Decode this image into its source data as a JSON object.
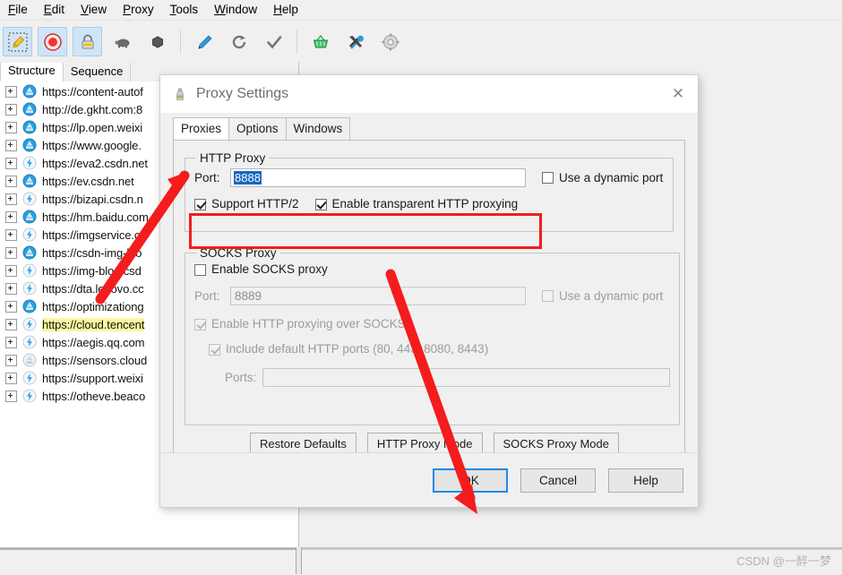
{
  "menubar": {
    "items": [
      {
        "label": "File",
        "accel": "F"
      },
      {
        "label": "Edit",
        "accel": "E"
      },
      {
        "label": "View",
        "accel": "V"
      },
      {
        "label": "Proxy",
        "accel": "P"
      },
      {
        "label": "Tools",
        "accel": "T"
      },
      {
        "label": "Window",
        "accel": "W"
      },
      {
        "label": "Help",
        "accel": "H"
      }
    ]
  },
  "toolbar": {
    "buttons": [
      {
        "name": "clear-session-icon",
        "selected": true
      },
      {
        "name": "record-icon",
        "selected": true
      },
      {
        "name": "ssl-lock-icon",
        "selected": true
      },
      {
        "name": "throttle-turtle-icon",
        "selected": false
      },
      {
        "name": "breakpoint-hexagon-icon",
        "selected": false
      },
      {
        "name": "compose-pen-icon",
        "selected": false
      },
      {
        "name": "repeat-refresh-icon",
        "selected": false
      },
      {
        "name": "validate-check-icon",
        "selected": false
      },
      {
        "name": "basket-icon",
        "selected": false
      },
      {
        "name": "tools-icon",
        "selected": false
      },
      {
        "name": "settings-gear-icon",
        "selected": false
      }
    ]
  },
  "left_panel": {
    "tabs": [
      {
        "label": "Structure",
        "active": true
      },
      {
        "label": "Sequence",
        "active": false
      }
    ],
    "tree_items": [
      {
        "url": "https://content-autof",
        "icon": "globe",
        "highlight": false
      },
      {
        "url": "http://de.gkht.com:8",
        "icon": "globe",
        "highlight": false
      },
      {
        "url": "https://lp.open.weixi",
        "icon": "globe",
        "highlight": false
      },
      {
        "url": "https://www.google.",
        "icon": "globe",
        "highlight": false
      },
      {
        "url": "https://eva2.csdn.net",
        "icon": "bolt",
        "highlight": false
      },
      {
        "url": "https://ev.csdn.net",
        "icon": "globe",
        "highlight": false
      },
      {
        "url": "https://bizapi.csdn.n",
        "icon": "bolt",
        "highlight": false
      },
      {
        "url": "https://hm.baidu.com",
        "icon": "globe",
        "highlight": false
      },
      {
        "url": "https://imgservice.cs",
        "icon": "bolt",
        "highlight": false
      },
      {
        "url": "https://csdn-img-blo",
        "icon": "globe",
        "highlight": false
      },
      {
        "url": "https://img-blog.csd",
        "icon": "bolt",
        "highlight": false
      },
      {
        "url": "https://dta.lenovo.cc",
        "icon": "bolt",
        "highlight": false
      },
      {
        "url": "https://optimizationg",
        "icon": "globe",
        "highlight": false
      },
      {
        "url": "https://cloud.tencent",
        "icon": "bolt",
        "highlight": true
      },
      {
        "url": "https://aegis.qq.com",
        "icon": "bolt",
        "highlight": false
      },
      {
        "url": "https://sensors.cloud",
        "icon": "globe-dim",
        "highlight": false
      },
      {
        "url": "https://support.weixi",
        "icon": "bolt",
        "highlight": false
      },
      {
        "url": "https://otheve.beaco",
        "icon": "bolt",
        "highlight": false
      }
    ]
  },
  "dialog": {
    "title": "Proxy Settings",
    "icon": "charles-bottle-icon",
    "close_label": "✕",
    "tabs": [
      {
        "label": "Proxies",
        "active": true
      },
      {
        "label": "Options",
        "active": false
      },
      {
        "label": "Windows",
        "active": false
      }
    ],
    "http_proxy": {
      "legend": "HTTP Proxy",
      "port_label": "Port:",
      "port_value": "8888",
      "port_selected": true,
      "dynamic_port_label": "Use a dynamic port",
      "dynamic_port_checked": false,
      "support_http2_label": "Support HTTP/2",
      "support_http2_checked": true,
      "transparent_label": "Enable transparent HTTP proxying",
      "transparent_checked": true
    },
    "socks_proxy": {
      "legend": "SOCKS Proxy",
      "enable_label": "Enable SOCKS proxy",
      "enable_checked": false,
      "port_label": "Port:",
      "port_value": "8889",
      "port_disabled": true,
      "dynamic_port_label": "Use a dynamic port",
      "dynamic_port_checked": false,
      "http_over_socks_label": "Enable HTTP proxying over SOCKS",
      "http_over_socks_checked": true,
      "default_ports_label": "Include default HTTP ports (80, 443, 8080, 8443)",
      "default_ports_checked": true,
      "ports_label": "Ports:",
      "ports_value": ""
    },
    "action_buttons": [
      {
        "label": "Restore Defaults"
      },
      {
        "label": "HTTP Proxy Mode"
      },
      {
        "label": "SOCKS Proxy Mode"
      }
    ],
    "footer_buttons": [
      {
        "label": "OK",
        "default": true
      },
      {
        "label": "Cancel",
        "default": false
      },
      {
        "label": "Help",
        "default": false
      }
    ]
  },
  "annotations": {
    "highlight_box_color": "#f41c1c",
    "arrow_color": "#f41c1c",
    "arrows": [
      {
        "name": "arrow-to-http2-checkbox",
        "from": [
          112,
          332
        ],
        "to": [
          205,
          198
        ]
      },
      {
        "name": "arrow-to-ok-button",
        "from": [
          436,
          307
        ],
        "to": [
          532,
          568
        ]
      }
    ]
  },
  "watermark": {
    "text": "CSDN @一醉一梦"
  }
}
